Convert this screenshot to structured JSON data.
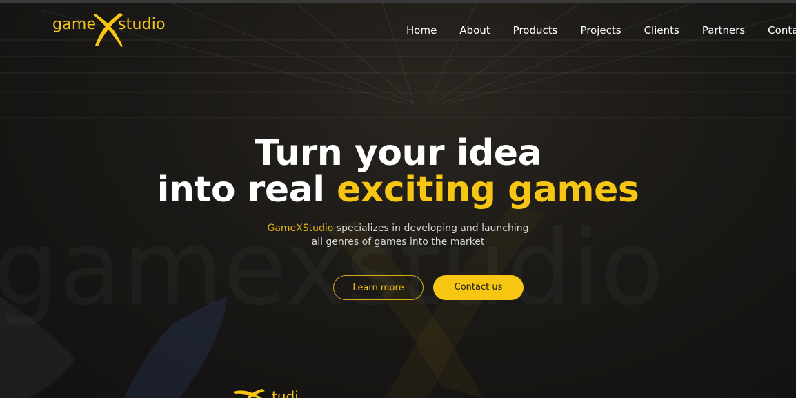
{
  "header": {
    "logo": {
      "part1": "game",
      "part2": "studio",
      "mark": "x-logo-icon"
    },
    "nav": [
      {
        "label": "Home"
      },
      {
        "label": "About"
      },
      {
        "label": "Products"
      },
      {
        "label": "Projects"
      },
      {
        "label": "Clients"
      },
      {
        "label": "Partners"
      },
      {
        "label": "Contact"
      }
    ]
  },
  "hero": {
    "title_line1": "Turn your idea",
    "title_line2_prefix": "into real ",
    "title_line2_highlight": "exciting games",
    "subtitle_brand": "GameXStudio",
    "subtitle_rest": " specializes in developing and launching",
    "subtitle_line2": "all genres of games into the market",
    "learn_more": "Learn more",
    "contact_us": "Contact us"
  },
  "background_watermark": "gamexstudio",
  "colors": {
    "accent": "#f7c613",
    "background": "#161412",
    "text": "#ffffff"
  }
}
